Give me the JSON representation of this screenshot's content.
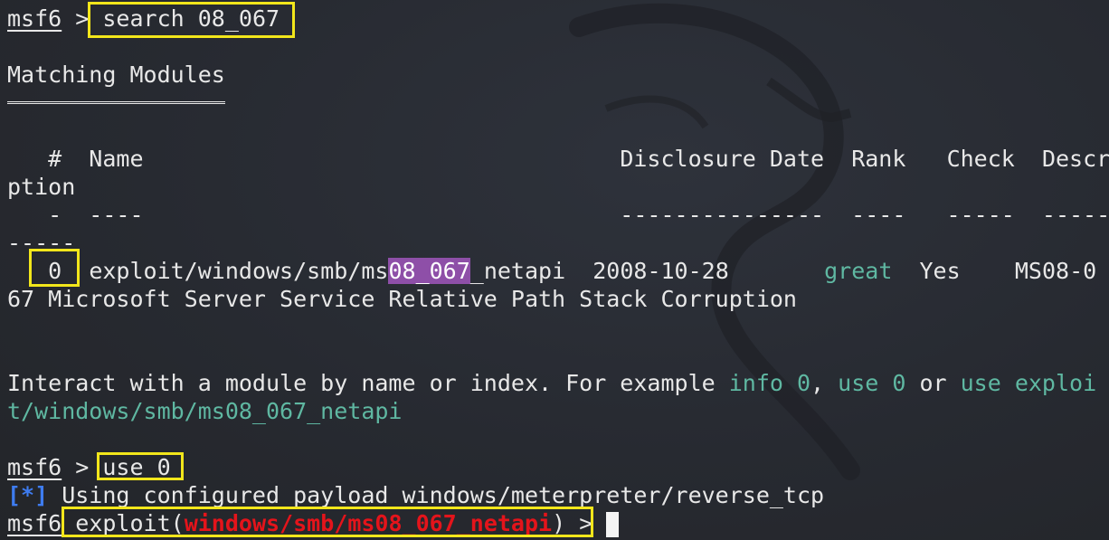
{
  "prompt": "msf6",
  "prompt_sep": " > ",
  "cmd_search": "search 08_067",
  "matching_title": "Matching Modules",
  "matching_rule": "================",
  "header_line1_pre": "   #  Name                                   ",
  "header_disclosure": "Disclosure Date",
  "header_gap1": "  ",
  "header_rank": "Rank",
  "header_gap2": "   ",
  "header_check": "Check",
  "header_gap3": "  ",
  "header_descri": "Descri",
  "header_line2": "ption",
  "under_line1": "   -  ----                                   ---------------  ----   -----  ------",
  "under_line2": "-----",
  "row_pre": "   ",
  "row_index": "0",
  "row_gap": "  ",
  "row_name_pre": "exploit/windows/smb/ms",
  "row_name_hl": "08_067",
  "row_name_post": "_netapi",
  "row_gap2": "  ",
  "row_date": "2008-10-28",
  "row_gap3": "       ",
  "row_rank": "great",
  "row_gap4": "  ",
  "row_check": "Yes",
  "row_gap5": "    ",
  "row_desc_part1": "MS08-0",
  "row_desc_part2": "67 Microsoft Server Service Relative Path Stack Corruption",
  "interact_text": "Interact with a module by name or index. For example ",
  "info0": "info 0",
  "comma": ", ",
  "use0": "use 0",
  "or_text": " or ",
  "use_exploit_part1": "use exploi",
  "use_exploit_part2": "t/windows/smb/ms08_067_netapi",
  "cmd_use": "use 0",
  "info_marker": "[*]",
  "info_text": " Using configured payload windows/meterpreter/reverse_tcp",
  "exploit_word": "exploit(",
  "exploit_module": "windows/smb/ms08_067_netapi",
  "exploit_close": ") >",
  "colors": {
    "background": "#262931",
    "text": "#e8e8e8",
    "teal": "#5fb8a2",
    "red": "#e4141b",
    "blue": "#3e7cf0",
    "highlight": "#8e4fa8",
    "box": "#f2e61b"
  }
}
